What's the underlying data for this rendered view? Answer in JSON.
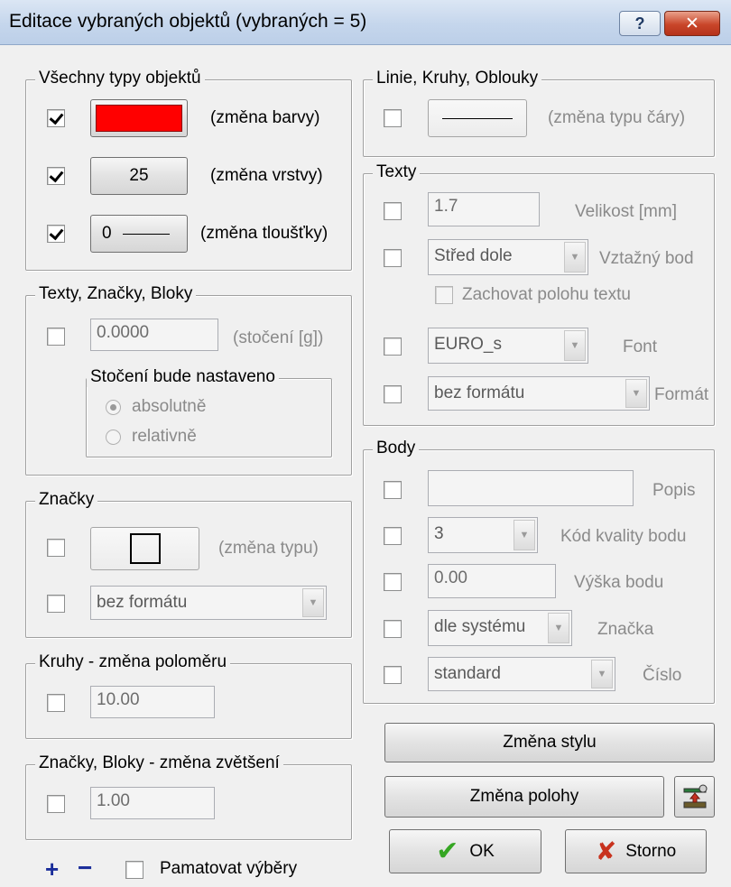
{
  "window": {
    "title": "Editace vybraných objektů  (vybraných = 5)",
    "help_glyph": "?",
    "close_glyph": "✕"
  },
  "all_types": {
    "legend": "Všechny typy objektů",
    "color_label": "(změna barvy)",
    "color_value": "#ff0000",
    "layer_value": "25",
    "layer_label": "(změna vrstvy)",
    "thickness_value": "0",
    "thickness_label": "(změna tloušťky)"
  },
  "texts_marks_blocks": {
    "legend": "Texty, Značky, Bloky",
    "rotation_value": "0.0000",
    "rotation_label": "(stočení [g])",
    "rotation_mode_legend": "Stočení bude nastaveno",
    "absolute_label": "absolutně",
    "relative_label": "relativně"
  },
  "marks": {
    "legend": "Značky",
    "type_label": "(změna typu)",
    "format_value": "bez formátu"
  },
  "circles": {
    "legend": "Kruhy - změna poloměru",
    "radius_value": "10.00"
  },
  "scale": {
    "legend": "Značky, Bloky - změna zvětšení",
    "scale_value": "1.00"
  },
  "bottom_left": {
    "plus": "+",
    "minus": "−",
    "remember_label": "Pamatovat výběry"
  },
  "lines": {
    "legend": "Linie, Kruhy, Oblouky",
    "line_type_label": "(změna typu čáry)"
  },
  "texts": {
    "legend": "Texty",
    "size_value": "1.7",
    "size_label": "Velikost [mm]",
    "anchor_value": "Střed dole",
    "anchor_label": "Vztažný bod",
    "keep_position_label": "Zachovat polohu textu",
    "font_value": "EURO_s",
    "font_label": "Font",
    "format_value": "bez formátu",
    "format_label": "Formát"
  },
  "points": {
    "legend": "Body",
    "description_value": "",
    "description_label": "Popis",
    "quality_value": "3",
    "quality_label": "Kód kvality bodu",
    "height_value": "0.00",
    "height_label": "Výška bodu",
    "mark_value": "dle systému",
    "mark_label": "Značka",
    "number_value": "standard",
    "number_label": "Číslo"
  },
  "actions": {
    "style_change": "Změna stylu",
    "position_change": "Změna polohy",
    "ok": "OK",
    "cancel": "Storno"
  }
}
